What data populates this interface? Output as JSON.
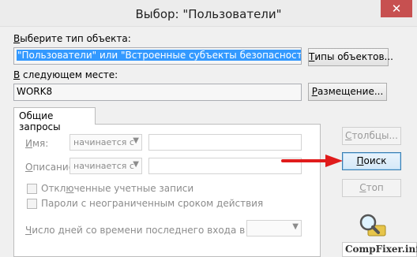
{
  "window": {
    "title": "Выбор: \"Пользователи\"",
    "close_glyph": "✕"
  },
  "object_type": {
    "label_key": "В",
    "label_rest": "ыберите тип объекта:",
    "value": "\"Пользователи\" или \"Встроенные субъекты безопасности\"",
    "button": {
      "key": "Т",
      "rest": "ипы объектов..."
    }
  },
  "location": {
    "label_key": "В",
    "label_rest": " следующем месте:",
    "value": "WORK8",
    "button": {
      "key": "Р",
      "rest": "азмещение..."
    }
  },
  "tab": {
    "label": "Общие запросы"
  },
  "query": {
    "name": {
      "label_key": "И",
      "label_rest": "мя:",
      "operator": "начинается с"
    },
    "description": {
      "label_key": "О",
      "label_rest": "писание:",
      "operator": "начинается с"
    },
    "disabled_accounts": {
      "label_pre": "Откл",
      "label_key": "ю",
      "label_post": "ченные учетные записи"
    },
    "no_expire_password": {
      "label_pre": "Пароли с неограниченным сроком действия"
    },
    "days_since_login": {
      "label_key": "Ч",
      "label_rest": "исло дней со времени последнего входа в систему:"
    }
  },
  "side_buttons": {
    "columns": {
      "key": "С",
      "rest": "толбцы..."
    },
    "search": {
      "key": "П",
      "rest": "оиск"
    },
    "stop": {
      "key": "С",
      "rest": "топ"
    }
  },
  "colors": {
    "arrow": "#e01b1b",
    "selection": "#3399ff",
    "close": "#c75050"
  },
  "watermark": {
    "text": "CompFixer.info"
  }
}
